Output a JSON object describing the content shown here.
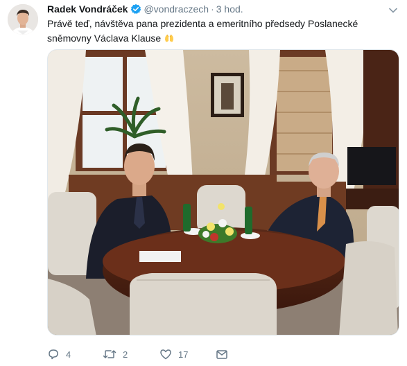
{
  "tweet": {
    "author_name": "Radek Vondráček",
    "handle": "@vondraczech",
    "separator": "·",
    "time": "3 hod.",
    "text": "Právě teď, návštěva pana prezidenta a emeritního předsedy Poslanecké sněmovny Václava Klause",
    "emoji_icon": "raised-hands-icon",
    "photo_icon": "photo"
  },
  "actions": {
    "replies": "4",
    "retweets": "2",
    "likes": "17",
    "message_icon": "envelope-icon"
  },
  "colors": {
    "accent": "#1da1f2",
    "muted": "#657786",
    "text": "#14171a"
  }
}
